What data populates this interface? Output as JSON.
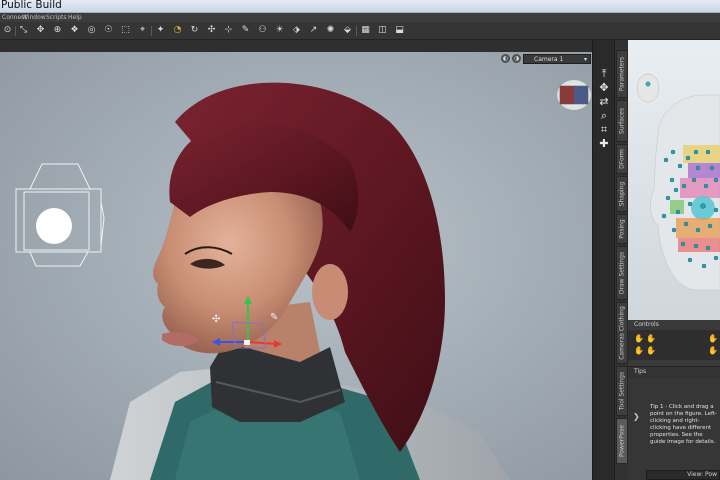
{
  "window": {
    "title": "Public Build"
  },
  "menu": [
    "Connect",
    "Window",
    "Scripts",
    "Help"
  ],
  "toolbar": {
    "icons": [
      "connect-icon",
      "pose-tool-icon",
      "node-weight-icon",
      "joint-editor-icon",
      "geometry-editor-icon",
      "region-nav-icon",
      "active-pose-icon",
      "surface-selection-icon",
      "rotate-tool-icon",
      "translate-tool-icon",
      "scale-tool-icon",
      "universal-tool-icon",
      "figure-tool-icon",
      "light-tool-icon",
      "edit-icon",
      "spot-render-icon",
      "preview-icon",
      "camera-tool-icon",
      "render-icon",
      "save-icon"
    ],
    "glyphs": [
      "⊙",
      "⤡",
      "✥",
      "⊕",
      "❖",
      "◎",
      "☉",
      "⬚",
      "⌖",
      "✦",
      "◔",
      "↻",
      "✣",
      "⊹",
      "✎",
      "⚇",
      "☀",
      "⬗",
      "↗",
      "✺",
      "⬙",
      "▦",
      "◫",
      "⬓"
    ]
  },
  "viewport": {
    "camera_label": "Camera 1",
    "camera_chevron": "▾",
    "btn_glyphs": [
      "◐",
      "◑"
    ]
  },
  "vtools": [
    "⤒",
    "✥",
    "⇄",
    "⌕",
    "⌗",
    "✚"
  ],
  "tabs": [
    "Parameters",
    "Surfaces",
    "DForm",
    "Shaping",
    "Posing",
    "Draw Settings",
    "Cameras Clothing",
    "Tool Settings",
    "PowerPose"
  ],
  "panel": {
    "controls_label": "Controls",
    "ctrl_glyphs": [
      "✋",
      "✋",
      "✋",
      "✋",
      "✋",
      "✋"
    ],
    "tips_label": "Tips",
    "tips_text": "Tip 1 - Click and drag a point on the figure. Left-clicking and right-clicking have different properties. See the guide image for details.",
    "tips_arrow": "❯",
    "bottom_label": "View: Pow"
  },
  "colors": {
    "accent": "#7ad3e0",
    "hair": "#5e1820",
    "vest": "#2f6a68"
  }
}
